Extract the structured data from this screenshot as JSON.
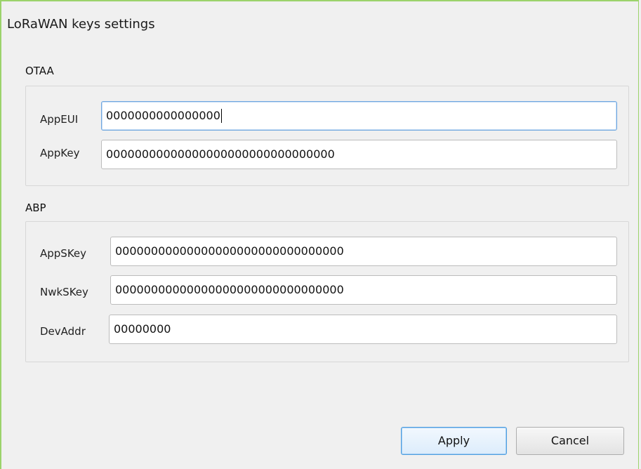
{
  "dialog": {
    "title": "LoRaWAN keys settings"
  },
  "otaa": {
    "label": "OTAA",
    "fields": [
      {
        "label": "AppEUI",
        "value": "0000000000000000"
      },
      {
        "label": "AppKey",
        "value": "00000000000000000000000000000000"
      }
    ]
  },
  "abp": {
    "label": "ABP",
    "fields": [
      {
        "label": "AppSKey",
        "value": "00000000000000000000000000000000"
      },
      {
        "label": "NwkSKey",
        "value": "00000000000000000000000000000000"
      },
      {
        "label": "DevAddr",
        "value": "00000000"
      }
    ]
  },
  "buttons": {
    "apply": "Apply",
    "cancel": "Cancel"
  }
}
